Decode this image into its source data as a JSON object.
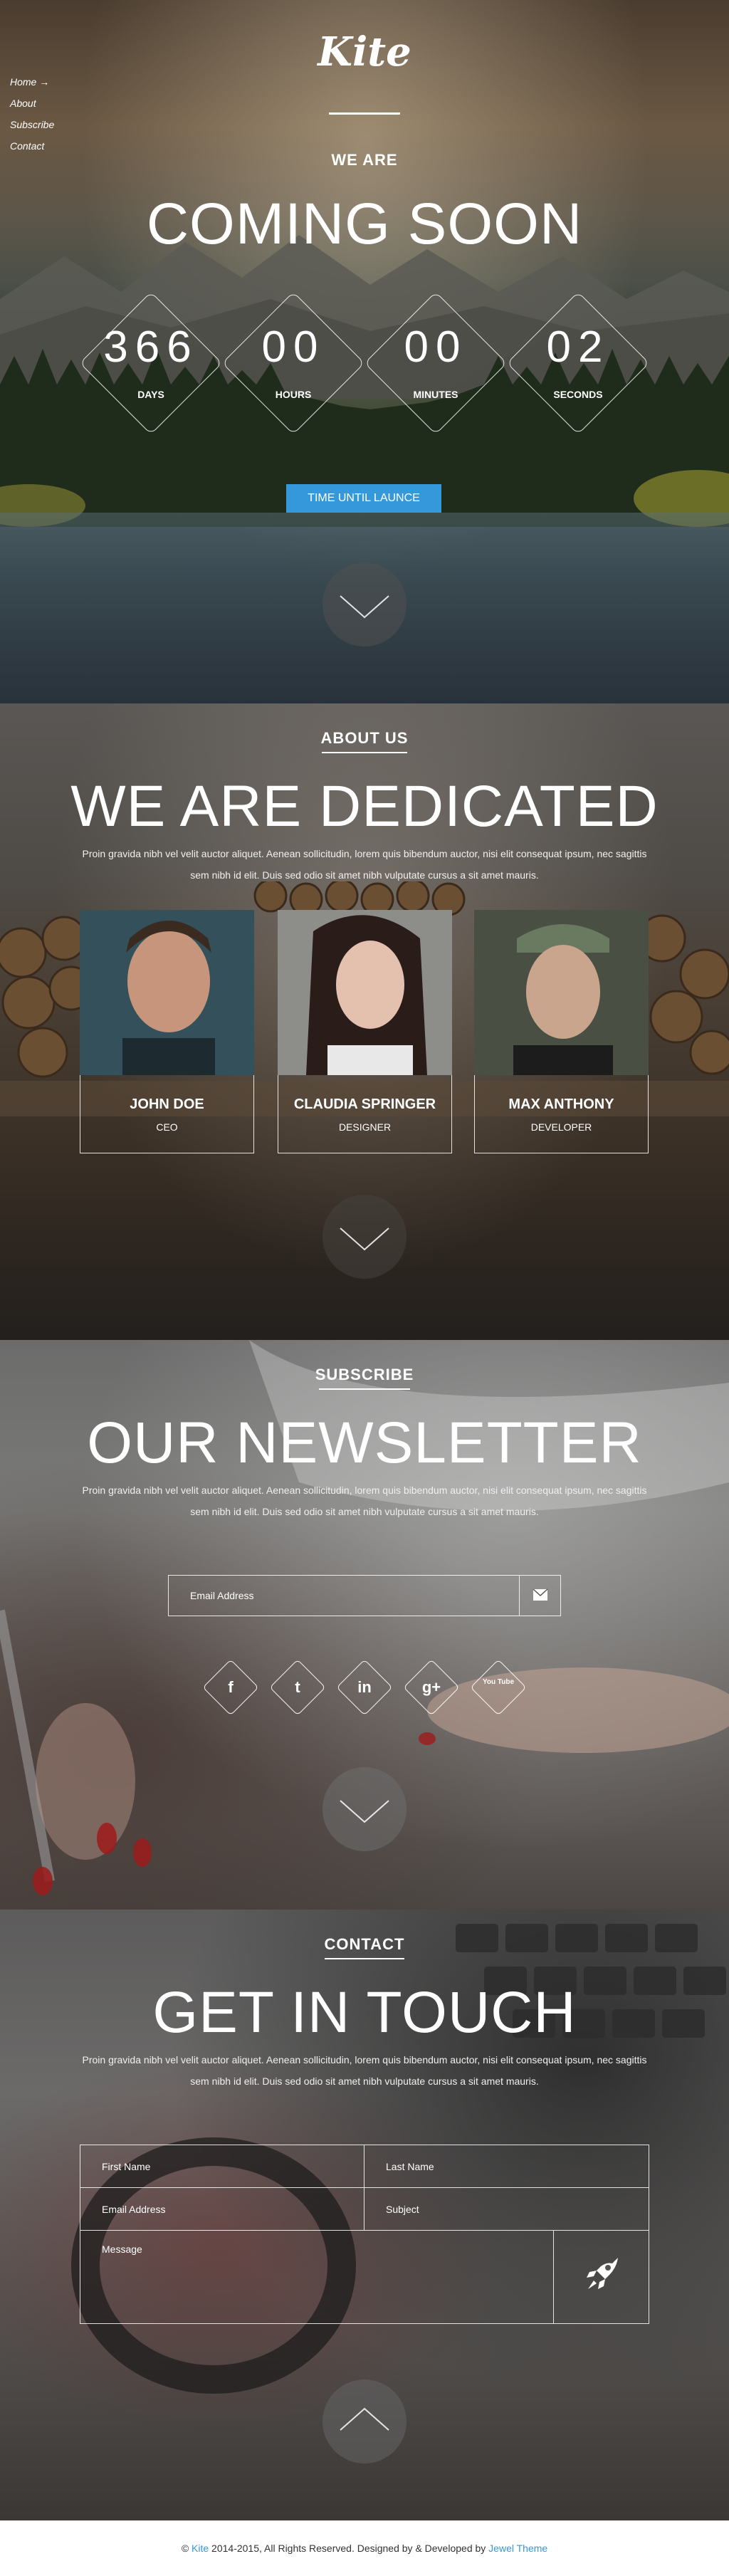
{
  "nav": {
    "items": [
      "Home",
      "About",
      "Subscribe",
      "Contact"
    ],
    "active_arrow": "→"
  },
  "hero": {
    "logo": "Kite",
    "kicker": "WE ARE",
    "title": "COMING SOON",
    "countdown": [
      {
        "value": "366",
        "label": "DAYS"
      },
      {
        "value": "00",
        "label": "HOURS"
      },
      {
        "value": "00",
        "label": "MINUTES"
      },
      {
        "value": "02",
        "label": "SECONDS"
      }
    ],
    "button": "TIME UNTIL LAUNCE"
  },
  "about": {
    "kicker": "ABOUT US",
    "title": "WE ARE DEDICATED",
    "text_line1": "Proin gravida nibh vel velit auctor aliquet. Aenean sollicitudin, lorem quis bibendum auctor, nisi elit consequat ipsum, nec sagittis",
    "text_line2": "sem nibh id elit. Duis sed odio sit amet nibh vulputate cursus a sit amet mauris.",
    "team": [
      {
        "name": "JOHN DOE",
        "role": "CEO"
      },
      {
        "name": "CLAUDIA SPRINGER",
        "role": "DESIGNER"
      },
      {
        "name": "MAX ANTHONY",
        "role": "DEVELOPER"
      }
    ]
  },
  "newsletter": {
    "kicker": "SUBSCRIBE",
    "title": "OUR NEWSLETTER",
    "text_line1": "Proin gravida nibh vel velit auctor aliquet. Aenean sollicitudin, lorem quis bibendum auctor, nisi elit consequat ipsum, nec sagittis",
    "text_line2": "sem nibh id elit. Duis sed odio sit amet nibh vulputate cursus a sit amet mauris.",
    "email_placeholder": "Email Address",
    "social": [
      {
        "icon": "facebook-icon",
        "glyph": "f"
      },
      {
        "icon": "twitter-icon",
        "glyph": "t"
      },
      {
        "icon": "linkedin-icon",
        "glyph": "in"
      },
      {
        "icon": "google-plus-icon",
        "glyph": "g+"
      },
      {
        "icon": "youtube-icon",
        "glyph": "You Tube"
      }
    ]
  },
  "contact": {
    "kicker": "CONTACT",
    "title": "GET IN TOUCH",
    "text_line1": "Proin gravida nibh vel velit auctor aliquet. Aenean sollicitudin, lorem quis bibendum auctor, nisi elit consequat ipsum, nec sagittis",
    "text_line2": "sem nibh id elit. Duis sed odio sit amet nibh vulputate cursus a sit amet mauris.",
    "first_name": "First Name",
    "last_name": "Last Name",
    "email": "Email Address",
    "subject": "Subject",
    "message": "Message"
  },
  "footer": {
    "prefix": "© ",
    "brand": "Kite",
    "middle": " 2014-2015, All Rights Reserved. Designed by & Developed by ",
    "author": "Jewel Theme"
  },
  "colors": {
    "accent": "#3498db",
    "footer_bg": "#ffffff",
    "footer_text": "#333333"
  }
}
